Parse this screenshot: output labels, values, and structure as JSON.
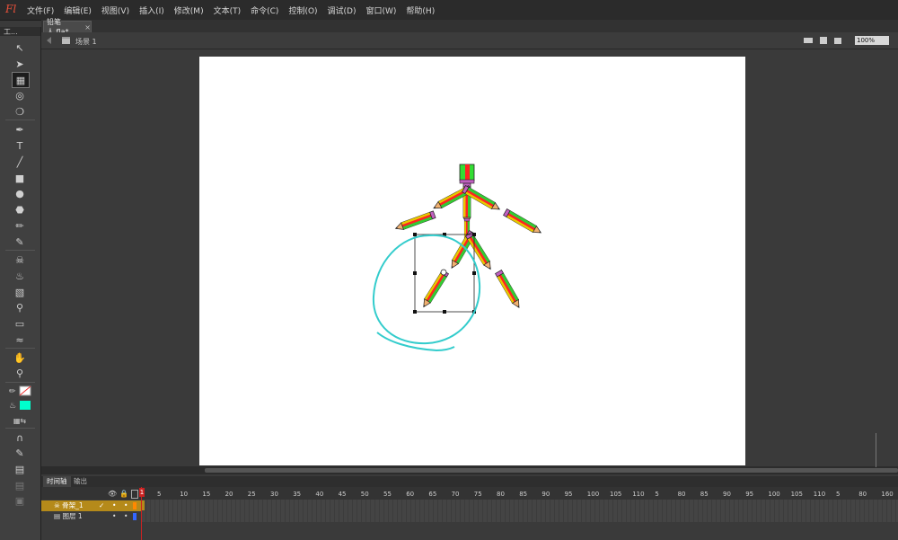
{
  "app": {
    "logo": "Fl"
  },
  "menu": [
    "文件(F)",
    "编辑(E)",
    "视图(V)",
    "插入(I)",
    "修改(M)",
    "文本(T)",
    "命令(C)",
    "控制(O)",
    "调试(D)",
    "窗口(W)",
    "帮助(H)"
  ],
  "tools_panel": {
    "title": "工..."
  },
  "document": {
    "tab_title": "铅笔人.fla*",
    "close": "×",
    "scene_label": "场景 1"
  },
  "zoom": {
    "value": "100%"
  },
  "timeline": {
    "tabs": [
      "时间轴",
      "输出"
    ],
    "ruler": [
      "1",
      "5",
      "10",
      "15",
      "20",
      "25",
      "30",
      "35",
      "40",
      "45",
      "50",
      "55",
      "60",
      "65",
      "70",
      "75",
      "80",
      "85",
      "90",
      "95",
      "100",
      "105",
      "110",
      "5",
      "80",
      "85",
      "90",
      "95",
      "100",
      "105",
      "110",
      "5",
      "80",
      "160",
      "16"
    ],
    "layers": [
      {
        "name": "骨架_1",
        "frame": "1"
      },
      {
        "name": "图层 1",
        "frame": "1"
      }
    ]
  },
  "colors": {
    "stroke": "#222222",
    "fill": "#00ffcc",
    "annotation": "#33cccc"
  }
}
